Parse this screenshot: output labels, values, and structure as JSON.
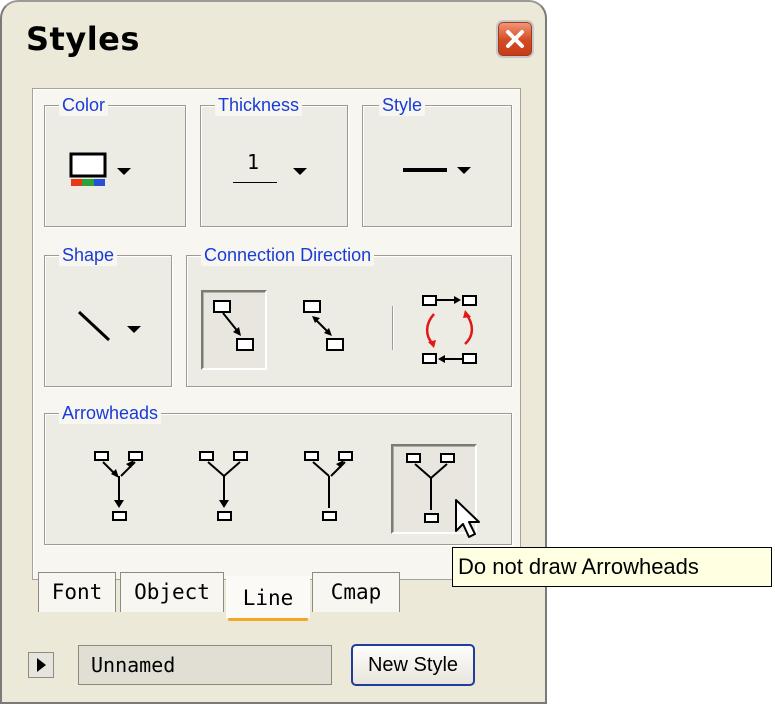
{
  "window": {
    "title": "Styles"
  },
  "groups": {
    "color": "Color",
    "thickness": "Thickness",
    "thickness_value": "1",
    "style": "Style",
    "shape": "Shape",
    "connection_direction": "Connection Direction",
    "arrowheads": "Arrowheads"
  },
  "arrowhead_options": [
    {
      "name": "both",
      "selected": false
    },
    {
      "name": "tail",
      "selected": false
    },
    {
      "name": "head",
      "selected": false
    },
    {
      "name": "none",
      "selected": true
    }
  ],
  "tooltip": "Do not draw Arrowheads",
  "tabs": [
    {
      "label": "Font",
      "active": false
    },
    {
      "label": "Object",
      "active": false
    },
    {
      "label": "Line",
      "active": true
    },
    {
      "label": "Cmap",
      "active": false
    }
  ],
  "footer": {
    "style_name": "Unnamed",
    "new_style_label": "New Style"
  },
  "colors": {
    "legend": "#1a3cd6",
    "tab_accent": "#f5a623",
    "close_button": "#d24a22"
  }
}
